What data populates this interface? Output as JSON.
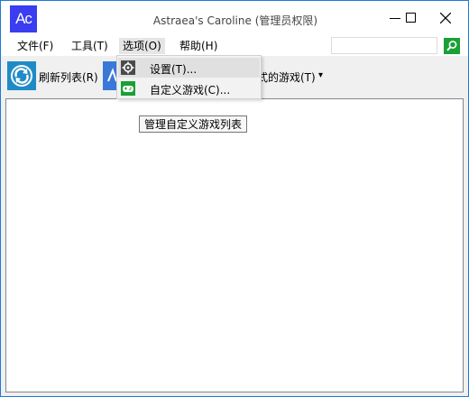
{
  "window": {
    "logo_text": "Ac",
    "title": "Astraea's Caroline (管理员权限)",
    "controls": [
      "minimize",
      "maximize",
      "close"
    ]
  },
  "menubar": {
    "items": [
      {
        "label": "文件(F)"
      },
      {
        "label": "工具(T)"
      },
      {
        "label": "选项(O)",
        "active": true
      },
      {
        "label": "帮助(H)"
      }
    ],
    "search": {
      "value": "",
      "placeholder": ""
    }
  },
  "toolbar": {
    "refresh_label": "刷新列表(R)",
    "games_label_visible": "式的游戏(T)",
    "games_dropdown_arrow": "▾"
  },
  "dropdown": {
    "items": [
      {
        "label": "设置(T)...",
        "icon": "gear-icon",
        "hover": true
      },
      {
        "label": "自定义游戏(C)...",
        "icon": "gamepad-icon"
      }
    ]
  },
  "tooltip": {
    "text": "管理自定义游戏列表"
  },
  "colors": {
    "logo_bg": "#3a3df0",
    "refresh_icon": "#1f8bc6",
    "search_button": "#1aa035",
    "gamepad_icon": "#1aa035",
    "window_border": "#1e7ad7"
  }
}
